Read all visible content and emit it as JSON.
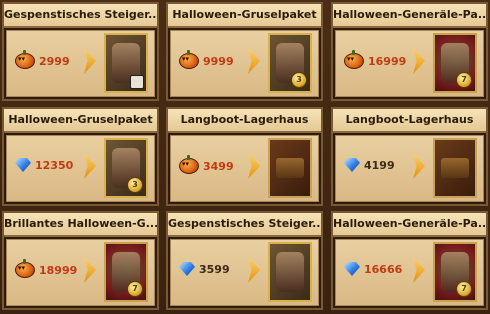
{
  "cards": [
    {
      "title": "Gespenstisches Steiger...",
      "cost": "2999",
      "currency": "pumpkin-icon",
      "thumb": "gold",
      "badge": "lock"
    },
    {
      "title": "Halloween-Gruselpaket",
      "cost": "9999",
      "currency": "pumpkin-icon",
      "thumb": "gold",
      "badge": "3"
    },
    {
      "title": "Halloween-Generäle-Pa...",
      "cost": "16999",
      "currency": "pumpkin-icon",
      "thumb": "red",
      "badge": "7"
    },
    {
      "title": "Halloween-Gruselpaket",
      "cost": "12350",
      "currency": "gem-icon",
      "thumb": "gold",
      "badge": "3"
    },
    {
      "title": "Langboot-Lagerhaus",
      "cost": "3499",
      "currency": "pumpkin-icon",
      "thumb": "dark",
      "badge": ""
    },
    {
      "title": "Langboot-Lagerhaus",
      "cost": "4199",
      "currency": "gem-icon",
      "thumb": "dark",
      "badge": ""
    },
    {
      "title": "Brillantes Halloween-G...",
      "cost": "18999",
      "currency": "pumpkin-icon",
      "thumb": "red",
      "badge": "7"
    },
    {
      "title": "Gespenstisches Steiger...",
      "cost": "3599",
      "currency": "gem-icon",
      "thumb": "gold",
      "badge": ""
    },
    {
      "title": "Halloween-Generäle-Pa...",
      "cost": "16666",
      "currency": "gem-icon",
      "thumb": "red",
      "badge": "7"
    }
  ]
}
